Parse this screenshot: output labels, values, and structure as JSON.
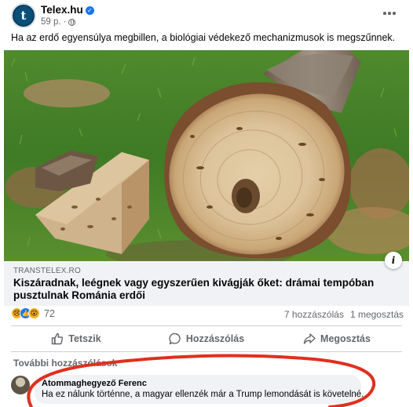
{
  "post": {
    "page_name": "Telex.hu",
    "avatar_letter": "t",
    "time": "59 p.",
    "text": "Ha az erdő egyensúlya megbillen, a biológiai védekező mechanizmusok is megszűnnek."
  },
  "link_preview": {
    "domain": "TRANSTELEX.RO",
    "headline": "Kiszáradnak, leégnek vagy egyszerűen kivágják őket: drámai tempóban pusztulnak Románia erdői"
  },
  "stats": {
    "reaction_count": "72",
    "comments": "7 hozzászólás",
    "shares": "1 megosztás"
  },
  "actions": {
    "like": "Tetszik",
    "comment": "Hozzászólás",
    "share": "Megosztás"
  },
  "comments_section": {
    "more_label": "További hozzászólások",
    "comment": {
      "author": "Atommaghegyező Ferenc",
      "text": "Ha ez nálunk történne, a magyar ellenzék már a Trump lemondását is követelné..."
    }
  },
  "colors": {
    "verified": "#1877f2",
    "muted_text": "#65676b",
    "panel": "#f0f2f5",
    "annotation": "#e0301e"
  },
  "icons": [
    "verified-icon",
    "globe-icon",
    "more-icon",
    "info-icon",
    "sad-reaction-icon",
    "like-reaction-icon",
    "wow-reaction-icon",
    "like-icon",
    "comment-icon",
    "share-icon"
  ]
}
